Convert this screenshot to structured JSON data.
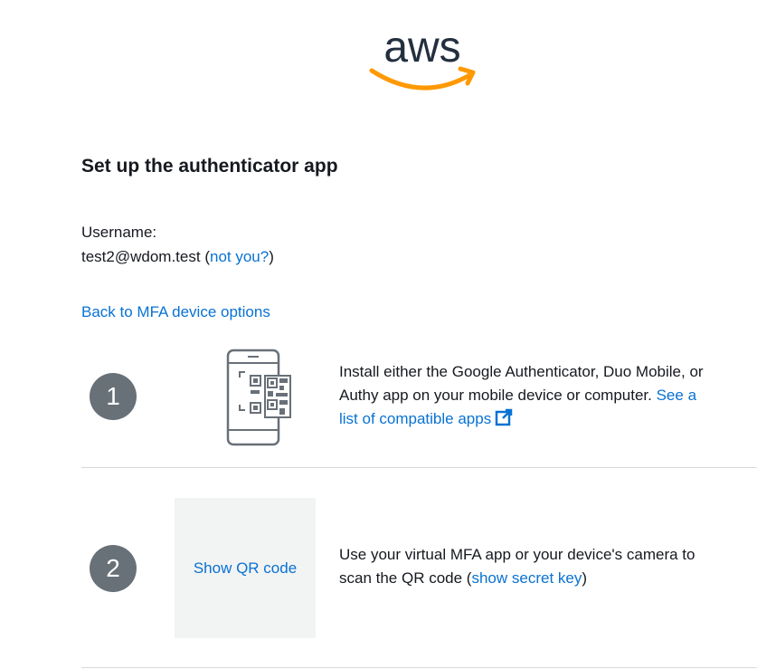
{
  "logo": {
    "text": "aws",
    "icon": "aws-logo-smile"
  },
  "page": {
    "title": "Set up the authenticator app"
  },
  "user": {
    "label": "Username:",
    "value": "test2@wdom.test",
    "open_paren": " (",
    "not_you_link": "not you?",
    "close_paren": ")"
  },
  "back_link": "Back to MFA device options",
  "steps": [
    {
      "number": "1",
      "icon": "phone-qr-illustration",
      "text": "Install either the Google Authenticator, Duo Mobile, or Authy app on your mobile device or computer. ",
      "link": "See a list of compatible apps",
      "link_icon": "external-link-icon"
    },
    {
      "number": "2",
      "qr_button": "Show QR code",
      "text": "Use your virtual MFA app or your device's camera to scan the QR code (",
      "link": "show secret key",
      "text_end": ")"
    }
  ],
  "colors": {
    "link": "#0972d3",
    "badge": "#687078",
    "aws_orange": "#ff9900",
    "aws_dark": "#232f3e"
  }
}
